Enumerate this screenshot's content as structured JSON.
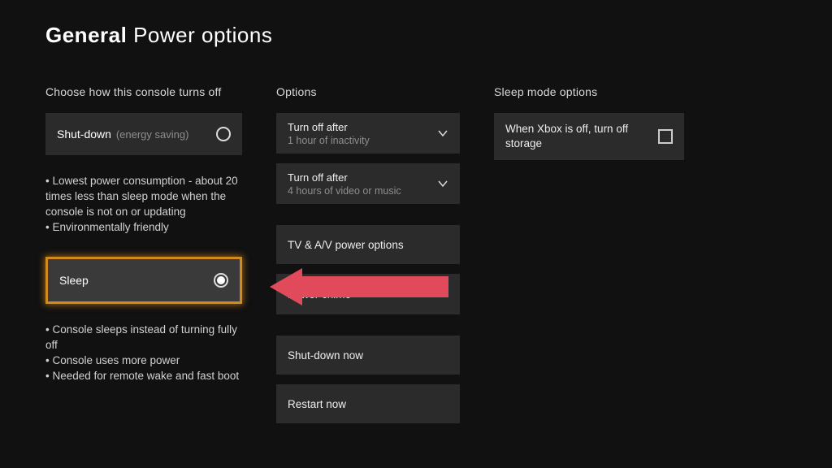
{
  "title": {
    "bold": "General",
    "rest": "Power options"
  },
  "left": {
    "heading": "Choose how this console turns off",
    "shutdown": {
      "label": "Shut-down",
      "sublabel": "(energy saving)",
      "selected": false
    },
    "shutdown_desc": [
      "• Lowest power consumption - about 20 times less than sleep mode when the console is not on or updating",
      "• Environmentally friendly"
    ],
    "sleep": {
      "label": "Sleep",
      "selected": true
    },
    "sleep_desc": [
      "• Console sleeps instead of turning fully off",
      "• Console uses more power",
      "• Needed for remote wake and fast boot"
    ]
  },
  "options": {
    "heading": "Options",
    "turnoff1": {
      "label": "Turn off after",
      "value": "1 hour of inactivity"
    },
    "turnoff2": {
      "label": "Turn off after",
      "value": "4 hours of video or music"
    },
    "tv_av": "TV & A/V power options",
    "chime": {
      "label": "Power chime",
      "value": ""
    },
    "shutdown_now": "Shut-down now",
    "restart_now": "Restart now"
  },
  "sleepmode": {
    "heading": "Sleep mode options",
    "storage": "When Xbox is off, turn off storage"
  }
}
